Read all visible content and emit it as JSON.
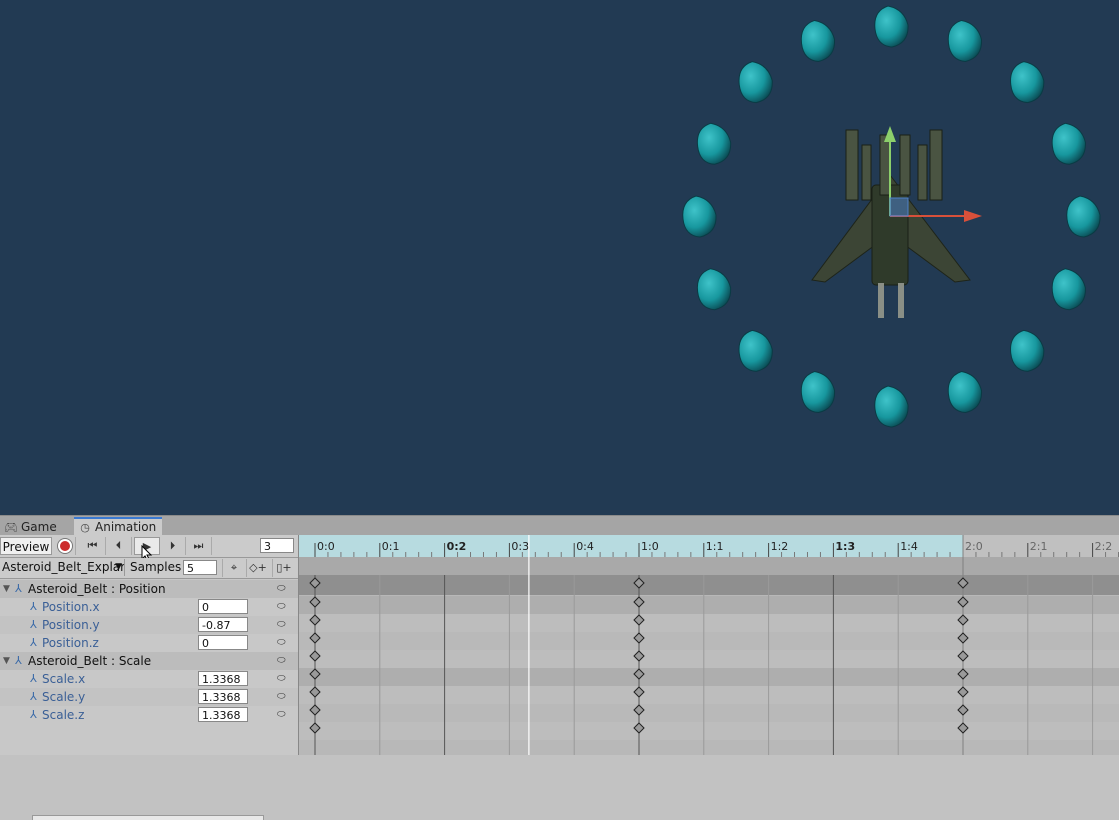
{
  "scene": {
    "background": "#223a53",
    "asteroid_color": "#17979e",
    "gizmo_colors": {
      "up": "#8ccf6b",
      "right": "#d8503a",
      "center": "#4d80c8"
    }
  },
  "tabs": [
    {
      "label": "Game",
      "icon": "gamepad-icon"
    },
    {
      "label": "Animation",
      "icon": "clock-icon",
      "active": true
    }
  ],
  "toolbar": {
    "preview_label": "Preview",
    "frame_value": "3"
  },
  "clip": {
    "name": "Asteroid_Belt_Explar",
    "samples_label": "Samples",
    "samples_value": "5"
  },
  "properties": [
    {
      "name": "Asteroid_Belt : Position",
      "group": true
    },
    {
      "name": "Position.x",
      "value": "0"
    },
    {
      "name": "Position.y",
      "value": "-0.87"
    },
    {
      "name": "Position.z",
      "value": "0"
    },
    {
      "name": "Asteroid_Belt : Scale",
      "group": true
    },
    {
      "name": "Scale.x",
      "value": "1.3368"
    },
    {
      "name": "Scale.y",
      "value": "1.3368"
    },
    {
      "name": "Scale.z",
      "value": "1.3368"
    }
  ],
  "timeline": {
    "ticks": [
      "0:0",
      "0:1",
      "0:2",
      "0:3",
      "0:4",
      "1:0",
      "1:1",
      "1:2",
      "1:3",
      "1:4",
      "2:0",
      "2:1",
      "2:2"
    ],
    "bold_ticks": [
      "0:2",
      "1:3"
    ],
    "clip_end": "2:0",
    "playhead": "0:3",
    "keyframe_times": [
      "0:0",
      "1:0",
      "2:0"
    ],
    "ruler_color": "#b7dbe0",
    "playhead_color": "#ffffff"
  }
}
